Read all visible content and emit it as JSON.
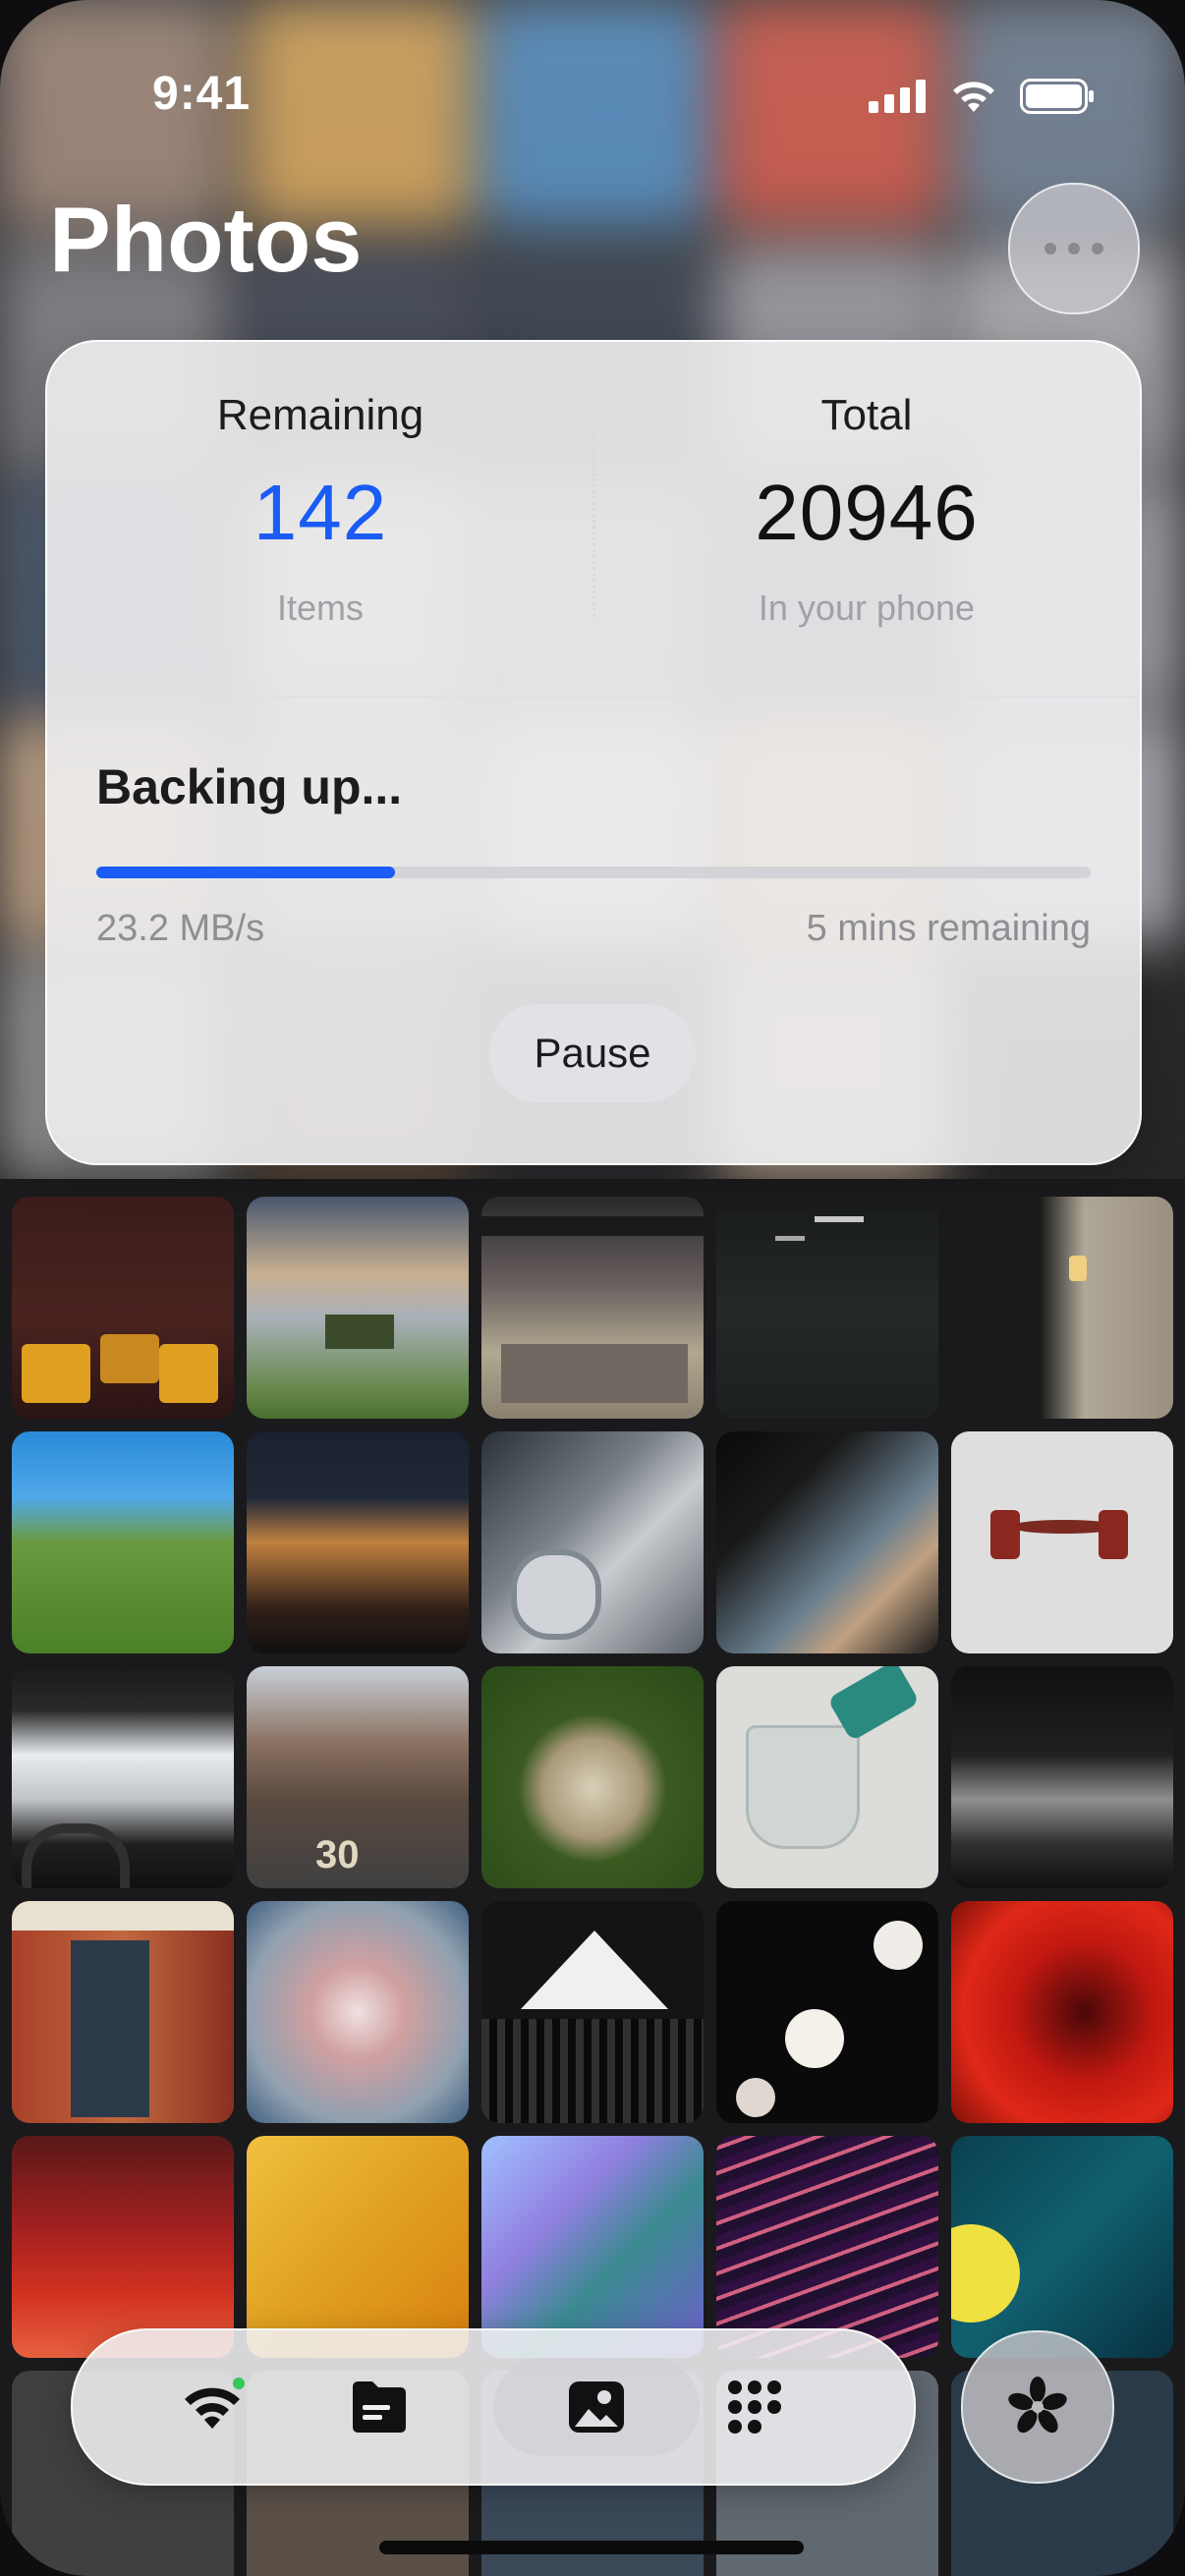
{
  "status_bar": {
    "time": "9:41"
  },
  "header": {
    "title": "Photos"
  },
  "stats": {
    "remaining": {
      "label": "Remaining",
      "value": "142",
      "unit": "Items"
    },
    "total": {
      "label": "Total",
      "value": "20946",
      "unit": "In your phone"
    }
  },
  "backup": {
    "title": "Backing up...",
    "progress_fraction": 0.3,
    "speed": "23.2 MB/s",
    "time_remaining": "5 mins remaining",
    "pause_label": "Pause"
  },
  "tabs": [
    {
      "name": "wifi-icon",
      "active": false
    },
    {
      "name": "files-icon",
      "active": false
    },
    {
      "name": "photos-icon",
      "active": true
    },
    {
      "name": "apps-grid-icon",
      "active": false
    }
  ],
  "fab": {
    "icon": "flower-icon"
  },
  "colors": {
    "accent": "#1a5cf5",
    "progress_track": "#d3d3d8",
    "wifi_dot": "#34c759"
  }
}
